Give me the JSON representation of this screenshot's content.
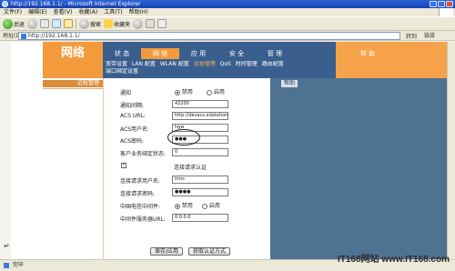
{
  "window": {
    "title": "http://192.168.1.1/ - Microsoft Internet Explorer"
  },
  "menu": [
    "文件(F)",
    "编辑(E)",
    "查看(V)",
    "收藏(A)",
    "工具(T)",
    "帮助(H)"
  ],
  "toolbar": {
    "back_label": "后退",
    "search_label": "搜索",
    "favorites_label": "收藏夹"
  },
  "address": {
    "label": "地址(D)",
    "url": "http://192.168.1.1/",
    "go_label": "转到",
    "links_label": "链接"
  },
  "router": {
    "logo": "网络",
    "tabs": [
      "状 态",
      "网 络",
      "应 用",
      "安 全",
      "管 理",
      "帮 助"
    ],
    "active_tab_index": 1,
    "subnav_row1": [
      "宽带设置",
      "LAN 配置",
      "WLAN 配置",
      "远程管理",
      "QoS",
      "时间管理",
      "路由配置"
    ],
    "subnav_row2": [
      "端口绑定设置"
    ],
    "section_title": "远程管理",
    "help_label": "帮助",
    "form": {
      "notify_label": "通知",
      "notify_disabled": "禁用",
      "notify_enabled": "启用",
      "notify_interval_label": "通知间隔:",
      "notify_interval_value": "43200",
      "acs_url_label": "ACS URL:",
      "acs_url_value": "http://devacs.edatahome",
      "acs_user_label": "ACS用户名:",
      "acs_user_value": "hgw",
      "acs_pass_label": "ACS密码:",
      "acs_pass_value": "●●●",
      "biz_status_label": "客户业务绑定状态:",
      "biz_status_value": "0",
      "conn_auth_label": "连接请求认证",
      "conn_user_label": "连接请求用户名:",
      "conn_user_value": "itms",
      "conn_pass_label": "连接请求密码:",
      "conn_pass_value": "●●●●",
      "middleware_label": "中国电信中间件:",
      "middleware_disabled": "禁用",
      "middleware_enabled": "启用",
      "middleware_server_label": "中间件服务器URL:",
      "middleware_server_value": "0.0.0.0",
      "save_button": "保存/应用",
      "cert_button": "获取认证方式"
    }
  },
  "status": {
    "text": "完毕"
  },
  "watermark": "IT168网站 www.IT168.com",
  "colors": {
    "orange": "#f6a24a",
    "nav_blue": "#3a5f8e",
    "help_panel": "#4f7293"
  }
}
